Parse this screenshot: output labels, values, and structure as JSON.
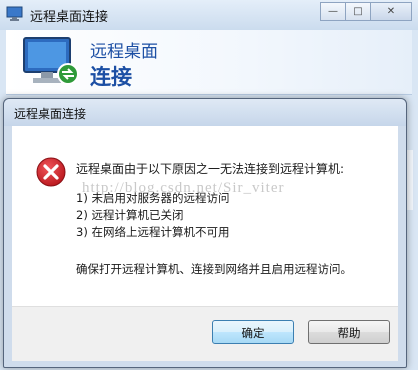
{
  "background_window": {
    "title": "远程桌面连接",
    "header_line1": "远程桌面",
    "header_line2": "连接",
    "controls": {
      "minimize": "—",
      "maximize": "□",
      "close": "✕"
    }
  },
  "dialog": {
    "title": "远程桌面连接",
    "message": "远程桌面由于以下原因之一无法连接到远程计算机:",
    "reasons": [
      "1) 未启用对服务器的远程访问",
      "2) 远程计算机已关闭",
      "3) 在网络上远程计算机不可用"
    ],
    "footer_message": "确保打开远程计算机、连接到网络并且启用远程访问。",
    "buttons": {
      "ok": "确定",
      "help": "帮助"
    }
  },
  "watermark": "http://blog.csdn.net/Sir_viter",
  "colors": {
    "accent": "#1c4fa4",
    "error": "#d41f25"
  }
}
